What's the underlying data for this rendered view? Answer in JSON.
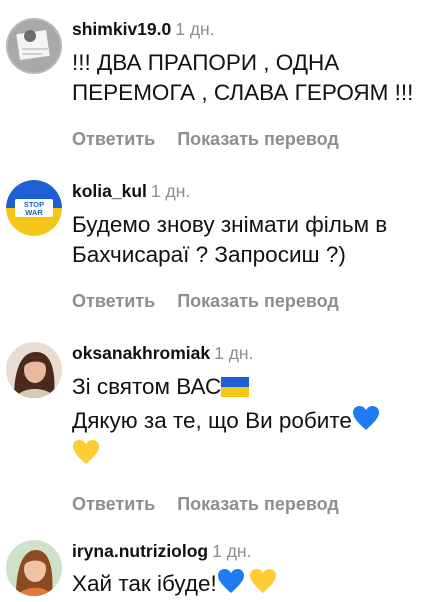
{
  "comments": [
    {
      "username": "shimkiv19.0",
      "time": "1 дн.",
      "lines": [
        "!!! ДВА ПРАПОРИ , ОДНА",
        "ПЕРЕМОГА , СЛАВА ГЕРОЯМ !!!"
      ],
      "reply": "Ответить",
      "translate": "Показать перевод",
      "avatar_icon": "person-holding-sign"
    },
    {
      "username": "kolia_kul",
      "time": "1 дн.",
      "lines": [
        "Будемо знову знімати фільм в",
        "Бахчисараї ? Запросиш ?)"
      ],
      "reply": "Ответить",
      "translate": "Показать перевод",
      "avatar_icon": "stop-war-badge",
      "avatar_text_1": "STOP",
      "avatar_text_2": "WAR"
    },
    {
      "username": "oksanakhromiak",
      "time": "1 дн.",
      "lines": [
        "Зі святом ВАС",
        "Дякую за те, що Ви робите"
      ],
      "reply": "Ответить",
      "translate": "Показать перевод",
      "avatar_icon": "woman-portrait"
    },
    {
      "username": "iryna.nutriziolog",
      "time": "1 дн.",
      "lines": [
        "Хай так ібуде!"
      ],
      "avatar_icon": "woman-portrait"
    }
  ],
  "colors": {
    "text": "#111111",
    "muted": "#8e8e8e",
    "ukraine_blue": "#1f5fd6",
    "ukraine_yellow": "#f5c518",
    "heart_blue": "#1e7bf0",
    "heart_yellow": "#ffcc33"
  }
}
